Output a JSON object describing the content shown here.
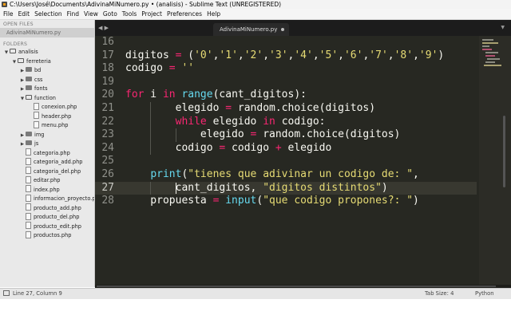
{
  "window": {
    "title": "C:\\Users\\José\\Documents\\AdivinaMiNumero.py • (analisis) - Sublime Text (UNREGISTERED)"
  },
  "menu": [
    "File",
    "Edit",
    "Selection",
    "Find",
    "View",
    "Goto",
    "Tools",
    "Project",
    "Preferences",
    "Help"
  ],
  "sidebar": {
    "open_files_label": "OPEN FILES",
    "open_file": "AdivinaMiNumero.py",
    "folders_label": "FOLDERS",
    "tree": [
      {
        "label": "analisis",
        "type": "folder",
        "open": true,
        "depth": 0
      },
      {
        "label": "ferreteria",
        "type": "folder",
        "open": true,
        "depth": 1
      },
      {
        "label": "bd",
        "type": "folder",
        "open": false,
        "depth": 2
      },
      {
        "label": "css",
        "type": "folder",
        "open": false,
        "depth": 2
      },
      {
        "label": "fonts",
        "type": "folder",
        "open": false,
        "depth": 2
      },
      {
        "label": "function",
        "type": "folder",
        "open": true,
        "depth": 2
      },
      {
        "label": "conexion.php",
        "type": "file",
        "depth": 3
      },
      {
        "label": "header.php",
        "type": "file",
        "depth": 3
      },
      {
        "label": "menu.php",
        "type": "file",
        "depth": 3
      },
      {
        "label": "img",
        "type": "folder",
        "open": false,
        "depth": 2
      },
      {
        "label": "js",
        "type": "folder",
        "open": false,
        "depth": 2
      },
      {
        "label": "categoria.php",
        "type": "file",
        "depth": 2
      },
      {
        "label": "categoria_add.php",
        "type": "file",
        "depth": 2
      },
      {
        "label": "categoria_del.php",
        "type": "file",
        "depth": 2
      },
      {
        "label": "editar.php",
        "type": "file",
        "depth": 2
      },
      {
        "label": "index.php",
        "type": "file",
        "depth": 2
      },
      {
        "label": "informacion_proyecto.php",
        "type": "file",
        "depth": 2
      },
      {
        "label": "producto_add.php",
        "type": "file",
        "depth": 2
      },
      {
        "label": "producto_del.php",
        "type": "file",
        "depth": 2
      },
      {
        "label": "producto_edit.php",
        "type": "file",
        "depth": 2
      },
      {
        "label": "productos.php",
        "type": "file",
        "depth": 2
      }
    ]
  },
  "tabs": {
    "nav": "◀ ▶",
    "active": "AdivinaMiNumero.py",
    "overflow": "▼"
  },
  "editor": {
    "current_line": 27,
    "lines": [
      {
        "n": "16",
        "tokens": []
      },
      {
        "n": "17",
        "tokens": [
          [
            "t",
            "digitos "
          ],
          [
            "o",
            "="
          ],
          [
            "t",
            " ("
          ],
          [
            "s",
            "'0'"
          ],
          [
            "t",
            ","
          ],
          [
            "s",
            "'1'"
          ],
          [
            "t",
            ","
          ],
          [
            "s",
            "'2'"
          ],
          [
            "t",
            ","
          ],
          [
            "s",
            "'3'"
          ],
          [
            "t",
            ","
          ],
          [
            "s",
            "'4'"
          ],
          [
            "t",
            ","
          ],
          [
            "s",
            "'5'"
          ],
          [
            "t",
            ","
          ],
          [
            "s",
            "'6'"
          ],
          [
            "t",
            ","
          ],
          [
            "s",
            "'7'"
          ],
          [
            "t",
            ","
          ],
          [
            "s",
            "'8'"
          ],
          [
            "t",
            ","
          ],
          [
            "s",
            "'9'"
          ],
          [
            "t",
            ")"
          ]
        ]
      },
      {
        "n": "18",
        "tokens": [
          [
            "t",
            "codigo "
          ],
          [
            "o",
            "="
          ],
          [
            "t",
            " "
          ],
          [
            "s",
            "''"
          ]
        ]
      },
      {
        "n": "19",
        "tokens": []
      },
      {
        "n": "20",
        "tokens": [
          [
            "k",
            "for"
          ],
          [
            "t",
            " i "
          ],
          [
            "k",
            "in"
          ],
          [
            "t",
            " "
          ],
          [
            "f",
            "range"
          ],
          [
            "t",
            "(cant_digitos):"
          ]
        ]
      },
      {
        "n": "21",
        "tokens": [
          [
            "t",
            "        elegido "
          ],
          [
            "o",
            "="
          ],
          [
            "t",
            " random.choice(digitos)"
          ]
        ]
      },
      {
        "n": "22",
        "tokens": [
          [
            "t",
            "        "
          ],
          [
            "k",
            "while"
          ],
          [
            "t",
            " elegido "
          ],
          [
            "k",
            "in"
          ],
          [
            "t",
            " codigo:"
          ]
        ]
      },
      {
        "n": "23",
        "tokens": [
          [
            "t",
            "            elegido "
          ],
          [
            "o",
            "="
          ],
          [
            "t",
            " random.choice(digitos)"
          ]
        ]
      },
      {
        "n": "24",
        "tokens": [
          [
            "t",
            "        codigo "
          ],
          [
            "o",
            "="
          ],
          [
            "t",
            " codigo "
          ],
          [
            "o",
            "+"
          ],
          [
            "t",
            " elegido"
          ]
        ]
      },
      {
        "n": "25",
        "tokens": []
      },
      {
        "n": "26",
        "tokens": [
          [
            "t",
            "    "
          ],
          [
            "f",
            "print"
          ],
          [
            "t",
            "("
          ],
          [
            "s",
            "\"tienes que adivinar un codigo de: \""
          ],
          [
            "t",
            ","
          ]
        ]
      },
      {
        "n": "27",
        "tokens": [
          [
            "t",
            "        cant_digitos, "
          ],
          [
            "s",
            "\"digitos distintos\""
          ],
          [
            "t",
            ")"
          ]
        ]
      },
      {
        "n": "28",
        "tokens": [
          [
            "t",
            "    propuesta "
          ],
          [
            "o",
            "="
          ],
          [
            "t",
            " "
          ],
          [
            "f",
            "input"
          ],
          [
            "t",
            "("
          ],
          [
            "s",
            "\"que codigo propones?: \""
          ],
          [
            "t",
            ")"
          ]
        ]
      }
    ]
  },
  "status": {
    "position": "Line 27, Column 9",
    "tab_size": "Tab Size: 4",
    "syntax": "Python"
  }
}
